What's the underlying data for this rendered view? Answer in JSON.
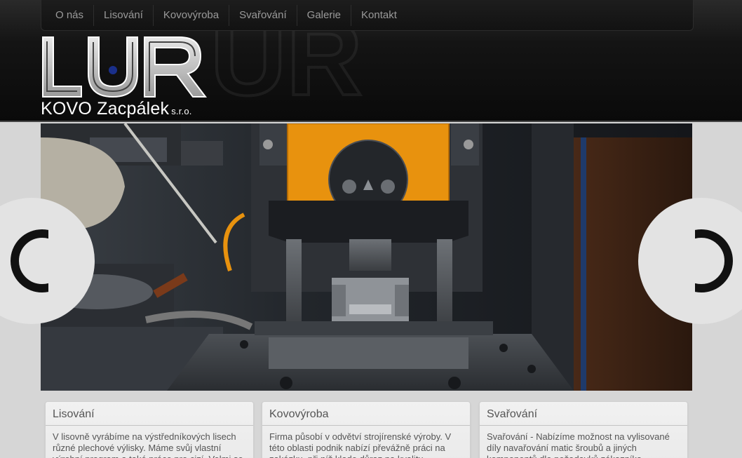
{
  "nav": {
    "items": [
      "O nás",
      "Lisování",
      "Kovovýroba",
      "Svařování",
      "Galerie",
      "Kontakt"
    ]
  },
  "logo": {
    "mark": "LUR",
    "company": "KOVO Zacpálek",
    "suffix": "s.r.o."
  },
  "slider": {
    "prev_icon": "chevron-left-icon",
    "next_icon": "chevron-right-icon"
  },
  "boxes": [
    {
      "title": "Lisování",
      "text": "V lisovně vyrábíme na výstředníkových lisech různé plechové výlisky. Máme svůj vlastní výrobní program a také práce pro cizí. Velmi se"
    },
    {
      "title": "Kovovýroba",
      "text": "Firma působí v odvětví strojírenské výroby. V této oblasti podnik nabízí převážně práci na zakázku, při níž klade důraz na kvalitu"
    },
    {
      "title": "Svařování",
      "text": "Svařování - Nabízíme možnost na vylisované díly navařování matic šroubů a jiných komponentů dle požadavků zákazníka"
    }
  ],
  "colors": {
    "header_bg": "#0a0a0a",
    "nav_text": "#9a9a9a",
    "page_bg": "#d6d6d6",
    "press_orange": "#e8920e"
  }
}
